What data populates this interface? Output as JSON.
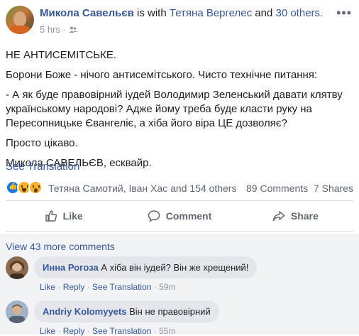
{
  "post": {
    "author": "Микола Савельєв",
    "with_text": "is with",
    "tagged": "Тетяна Вергелес",
    "and_text": "and",
    "others": "30 others.",
    "time": "5 hrs",
    "more_icon": "more-horizontal-icon",
    "paragraphs": [
      "НЕ АНТИСЕМІТСЬКЕ.",
      "Борони Боже - нічого антисемітського. Чисто технічне питання:",
      "- А як буде правовірний іудей Володимир Зеленський давати клятву українському народові? Адже йому треба буде класти руку на Пересопницьке Євангеліє, а хіба його віра ЦЕ дозволяє?",
      "Просто цікаво.",
      "Микола САВЕЛЬЄВ, есквайр."
    ],
    "see_translation": "See Translation"
  },
  "reactions": {
    "reactors": "Тетяна Самотий, Іван Хас and 154 others",
    "comments": "89 Comments",
    "shares": "7 Shares"
  },
  "actions": {
    "like": "Like",
    "comment": "Comment",
    "share": "Share"
  },
  "comments": {
    "view_more": "View 43 more comments",
    "items": [
      {
        "author": "Инна Рогоза",
        "text": "А хіба він іудей? Він же хрещений!",
        "like": "Like",
        "reply": "Reply",
        "see_translation": "See Translation",
        "time": "59m"
      },
      {
        "author": "Andriy Kolomyyets",
        "text": "Він не правовірний",
        "like": "Like",
        "reply": "Reply",
        "see_translation": "See Translation",
        "time": "55m"
      }
    ]
  },
  "colors": {
    "link": "#385898",
    "muted": "#90949c",
    "comments_bg": "#f2f3f5",
    "bubble": "#e4e6eb"
  }
}
